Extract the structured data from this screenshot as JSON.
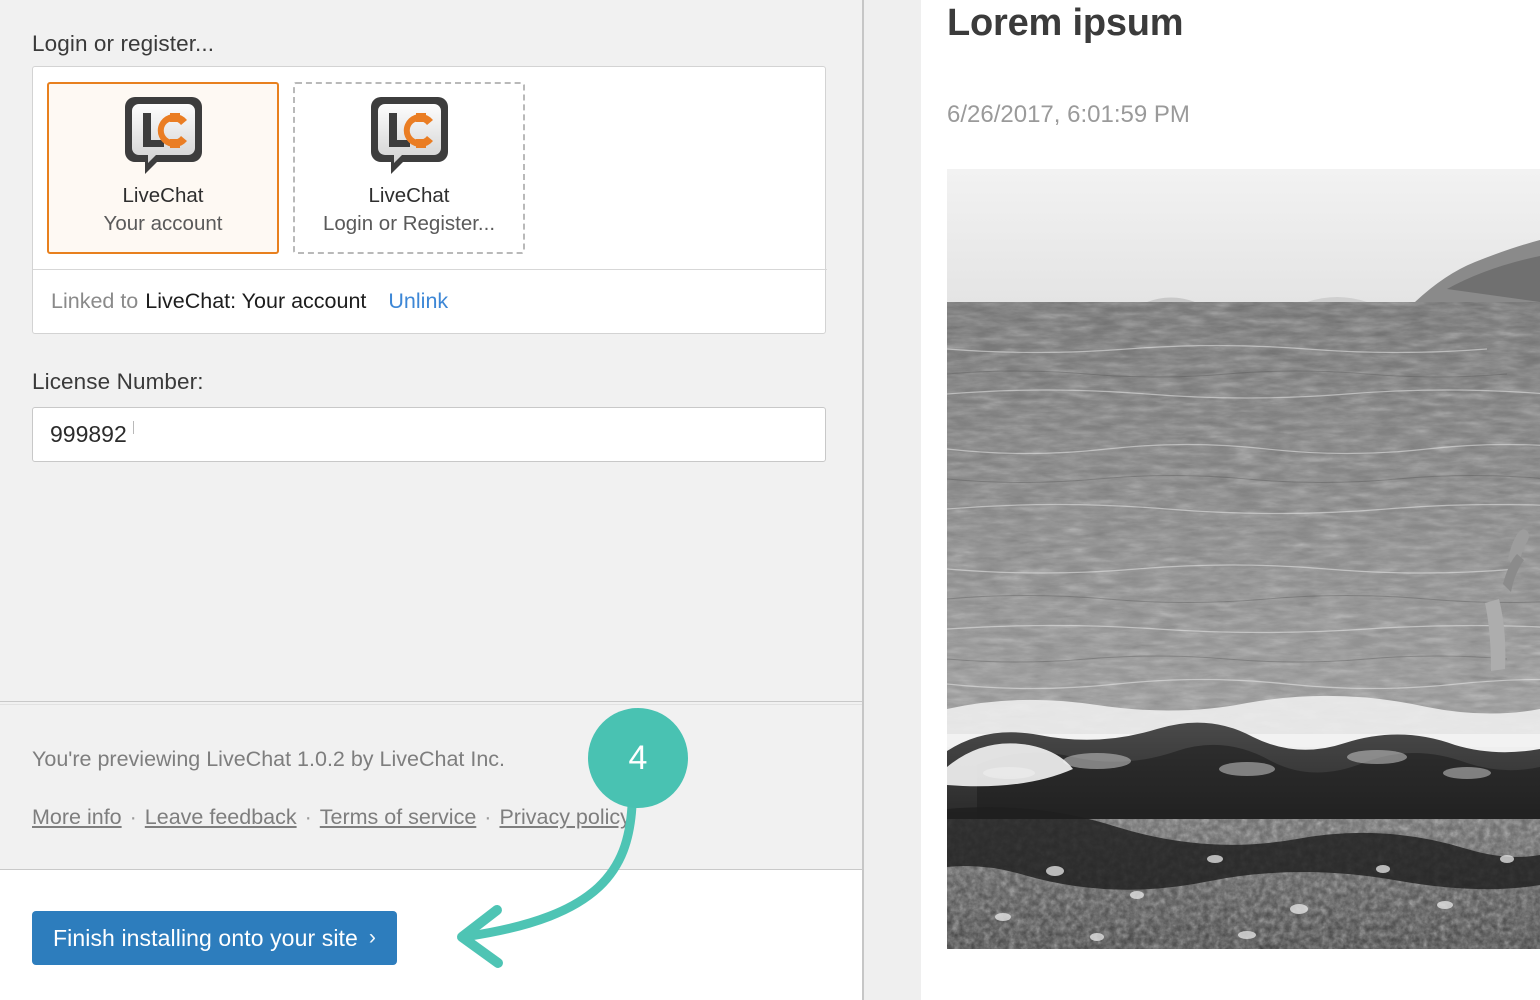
{
  "colors": {
    "accent_orange": "#e8801e",
    "link_blue": "#3d87d6",
    "button_blue": "#2d7dbd",
    "callout_teal": "#49c2b2",
    "panel_bg": "#f1f1f1"
  },
  "settings": {
    "login_label": "Login or register...",
    "accounts": [
      {
        "icon": "livechat-logo-icon",
        "title": "LiveChat",
        "subtitle": "Your account",
        "selected": true
      },
      {
        "icon": "livechat-logo-icon",
        "title": "LiveChat",
        "subtitle": "Login or Register...",
        "selected": false
      }
    ],
    "linked": {
      "prefix": "Linked to",
      "account": "LiveChat: Your account",
      "unlink_label": "Unlink"
    },
    "license": {
      "label": "License Number:",
      "value": "999892",
      "placeholder": "License Number"
    }
  },
  "credits": {
    "preview_note": "You're previewing LiveChat 1.0.2 by LiveChat Inc.",
    "separator": "·",
    "links": [
      "More info",
      "Leave feedback",
      "Terms of service",
      "Privacy policy"
    ]
  },
  "action_bar": {
    "finish_label": "Finish installing onto your site",
    "finish_chevron": "›"
  },
  "preview": {
    "title": "Lorem ipsum",
    "date": "6/26/2017, 6:01:59 PM",
    "photo_alt": "black and white photo of a rocky seashore with waves"
  },
  "callout": {
    "step_number": "4"
  }
}
